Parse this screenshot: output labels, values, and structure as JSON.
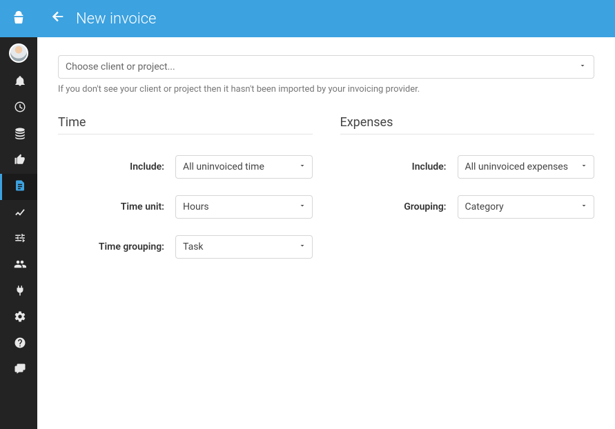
{
  "header": {
    "title": "New invoice"
  },
  "client_picker": {
    "placeholder": "Choose client or project...",
    "hint": "If you don't see your client or project then it hasn't been imported by your invoicing provider."
  },
  "time": {
    "section_label": "Time",
    "include_label": "Include:",
    "include_value": "All uninvoiced time",
    "unit_label": "Time unit:",
    "unit_value": "Hours",
    "grouping_label": "Time grouping:",
    "grouping_value": "Task"
  },
  "expenses": {
    "section_label": "Expenses",
    "include_label": "Include:",
    "include_value": "All uninvoiced expenses",
    "grouping_label": "Grouping:",
    "grouping_value": "Category"
  },
  "sidebar": {
    "icons": [
      "logo-icon",
      "avatar",
      "bell-icon",
      "clock-icon",
      "database-icon",
      "thumbs-up-icon",
      "invoice-icon",
      "chart-icon",
      "sliders-icon",
      "users-icon",
      "plug-icon",
      "gear-icon",
      "help-icon",
      "chat-icon"
    ]
  }
}
